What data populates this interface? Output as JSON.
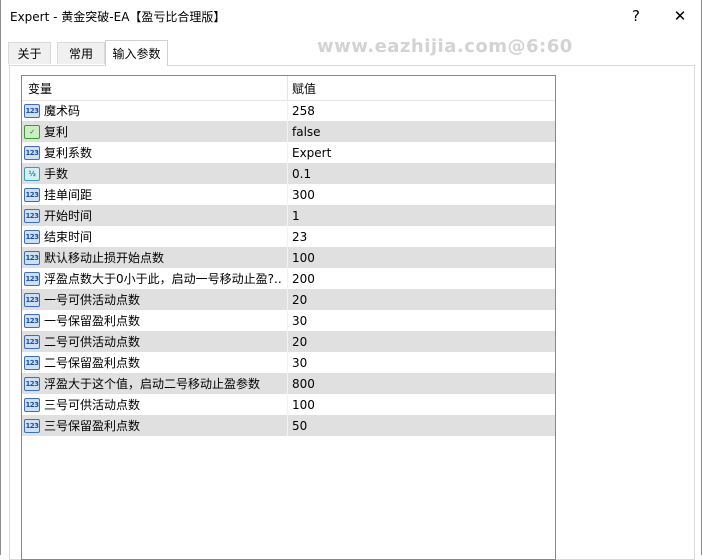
{
  "window": {
    "title": "Expert - 黄金突破-EA【盈亏比合理版】",
    "help_glyph": "?",
    "close_glyph": "✕"
  },
  "tabs": [
    {
      "label": "关于",
      "active": false
    },
    {
      "label": "常用",
      "active": false
    },
    {
      "label": "输入参数",
      "active": true
    }
  ],
  "watermark": "www.eazhijia.com@6:60",
  "grid": {
    "headers": {
      "variable": "变量",
      "value": "赋值"
    },
    "rows": [
      {
        "icon": "int-icon",
        "icon_text": "123",
        "name": "魔术码",
        "value": "258"
      },
      {
        "icon": "bool-icon",
        "icon_text": "✓",
        "name": "复利",
        "value": "false"
      },
      {
        "icon": "enum-icon",
        "icon_text": "123",
        "name": "复利系数",
        "value": "Expert"
      },
      {
        "icon": "double-icon",
        "icon_text": "½",
        "name": "手数",
        "value": "0.1"
      },
      {
        "icon": "int-icon",
        "icon_text": "123",
        "name": "挂单间距",
        "value": "300"
      },
      {
        "icon": "int-icon",
        "icon_text": "123",
        "name": "开始时间",
        "value": "1"
      },
      {
        "icon": "int-icon",
        "icon_text": "123",
        "name": "结束时间",
        "value": "23"
      },
      {
        "icon": "int-icon",
        "icon_text": "123",
        "name": "默认移动止损开始点数",
        "value": "100"
      },
      {
        "icon": "int-icon",
        "icon_text": "123",
        "name": "浮盈点数大于0小于此，启动一号移动止盈?..",
        "value": "200"
      },
      {
        "icon": "int-icon",
        "icon_text": "123",
        "name": "一号可供活动点数",
        "value": "20"
      },
      {
        "icon": "int-icon",
        "icon_text": "123",
        "name": "一号保留盈利点数",
        "value": "30"
      },
      {
        "icon": "int-icon",
        "icon_text": "123",
        "name": "二号可供活动点数",
        "value": "20"
      },
      {
        "icon": "int-icon",
        "icon_text": "123",
        "name": "二号保留盈利点数",
        "value": "30"
      },
      {
        "icon": "int-icon",
        "icon_text": "123",
        "name": "浮盈大于这个值，启动二号移动止盈参数",
        "value": "800"
      },
      {
        "icon": "int-icon",
        "icon_text": "123",
        "name": "三号可供活动点数",
        "value": "100"
      },
      {
        "icon": "int-icon",
        "icon_text": "123",
        "name": "三号保留盈利点数",
        "value": "50"
      }
    ]
  },
  "colors": {
    "row_alt": "#e0e0e0",
    "grid_border": "#828790"
  }
}
